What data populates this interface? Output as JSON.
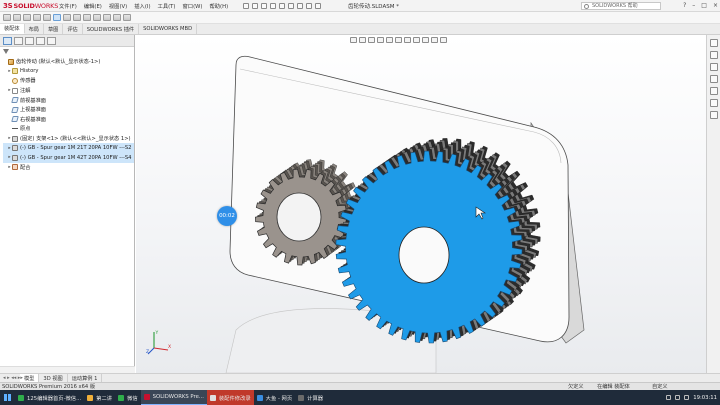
{
  "window": {
    "logo_prefix": "3S",
    "logo_solid": "SOLID",
    "logo_works": "WORKS",
    "title": "齿轮传动.SLDASM *",
    "search_placeholder": "SOLIDWORKS 帮助",
    "controls": [
      "?",
      "–",
      "□",
      "×"
    ]
  },
  "menu": [
    "文件(F)",
    "编辑(E)",
    "视图(V)",
    "插入(I)",
    "工具(T)",
    "窗口(W)",
    "帮助(H)"
  ],
  "command_tabs": [
    {
      "label": "装配体",
      "active": true
    },
    {
      "label": "布局",
      "active": false
    },
    {
      "label": "草图",
      "active": false
    },
    {
      "label": "评估",
      "active": false
    },
    {
      "label": "SOLIDWORKS 插件",
      "active": false
    },
    {
      "label": "SOLIDWORKS MBD",
      "active": false
    }
  ],
  "feature_tree": [
    {
      "label": "齿轮传动 (默认<默认_显示状态-1>)",
      "icon": "asm",
      "level": 0,
      "expander": ""
    },
    {
      "label": "History",
      "icon": "folder",
      "level": 1,
      "expander": "▸"
    },
    {
      "label": "传感器",
      "icon": "sensor",
      "level": 1,
      "expander": ""
    },
    {
      "label": "注解",
      "icon": "note",
      "level": 1,
      "expander": "▸"
    },
    {
      "label": "前视基准面",
      "icon": "plane",
      "level": 1,
      "expander": ""
    },
    {
      "label": "上视基准面",
      "icon": "plane",
      "level": 1,
      "expander": ""
    },
    {
      "label": "右视基准面",
      "icon": "plane",
      "level": 1,
      "expander": ""
    },
    {
      "label": "原点",
      "icon": "orig",
      "level": 1,
      "expander": ""
    },
    {
      "label": "(固定) 支架<1> (默认<<默认>_显示状态 1>)",
      "icon": "part",
      "level": 1,
      "expander": "▸"
    },
    {
      "label": "(-) GB - Spur gear 1M 21T 20PA 10FW ---S2",
      "icon": "part",
      "level": 1,
      "expander": "▸",
      "highlight": true
    },
    {
      "label": "(-) GB - Spur gear 1M 42T 20PA 10FW ---S4",
      "icon": "part",
      "level": 1,
      "expander": "▸",
      "highlight": true
    },
    {
      "label": "配合",
      "icon": "mate",
      "level": 1,
      "expander": "▸"
    }
  ],
  "viewport": {
    "timer_label": "00:02",
    "triad_x": "X",
    "triad_y": "Y",
    "triad_z": "Z",
    "colors": {
      "large_gear": "#1e9be8",
      "small_gear": "#9a938d",
      "bracket": "#f4f4f4"
    }
  },
  "model_tabs": [
    {
      "label": "模型",
      "active": true
    },
    {
      "label": "3D 视图",
      "active": false
    },
    {
      "label": "运动算例 1",
      "active": false
    }
  ],
  "status": {
    "app": "SOLIDWORKS Premium 2016 x64 版",
    "state1": "欠定义",
    "state2": "在编辑 装配体",
    "units": "自定义"
  },
  "taskbar": [
    {
      "label": "125编辑器首页-微信...",
      "color": "#2fae4b",
      "active": false
    },
    {
      "label": "第二讲",
      "color": "#f0b03a",
      "active": false
    },
    {
      "label": "微信",
      "color": "#2fae4b",
      "active": false
    },
    {
      "label": "SOLIDWORKS Pre...",
      "color": "#c8102e",
      "active": true
    },
    {
      "label": "装配件修改录",
      "color": "#e0e0e0",
      "active": false,
      "hot": true
    },
    {
      "label": "大鱼 - 网页",
      "color": "#3a8de0",
      "active": false
    },
    {
      "label": "计算器",
      "color": "#6a6a6a",
      "active": false
    }
  ],
  "tray": {
    "time": "19:03:11"
  }
}
